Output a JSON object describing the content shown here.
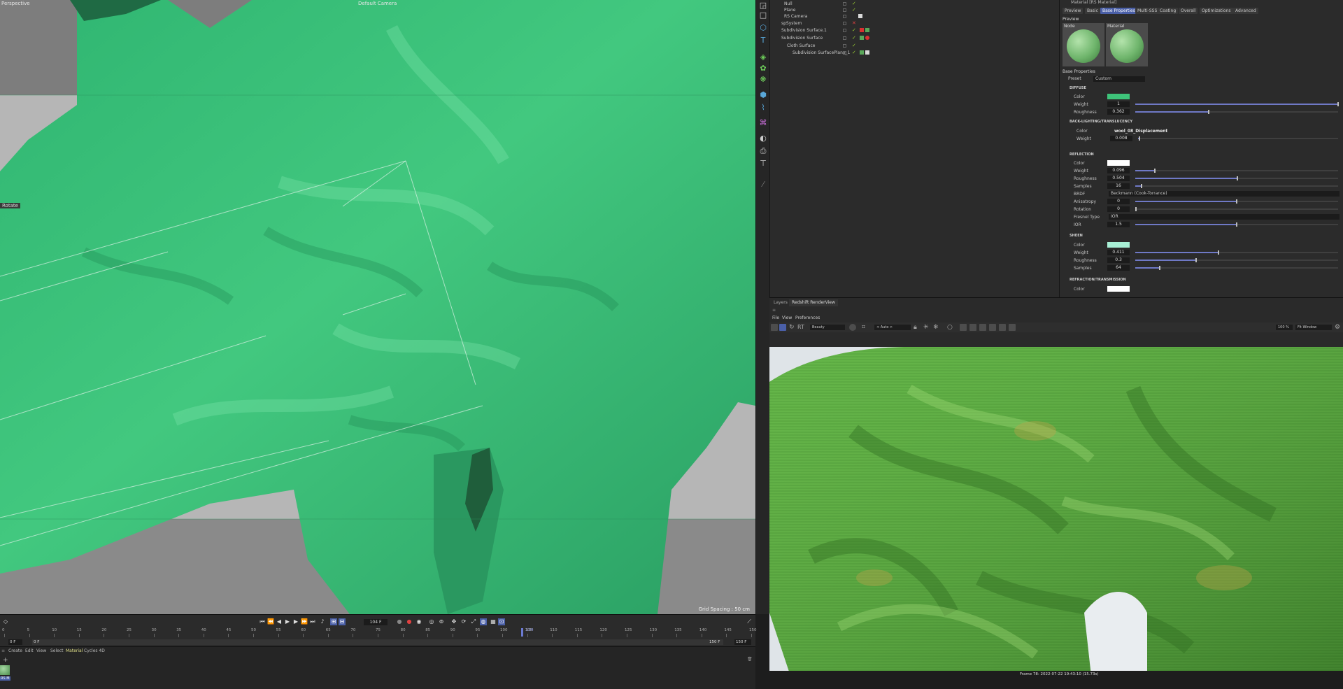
{
  "viewport": {
    "view_name": "Perspective",
    "camera": "Default Camera",
    "rotate_hint": "Rotate",
    "grid_spacing": "Grid Spacing : 50 cm"
  },
  "object_manager": {
    "objects": [
      {
        "name": "Null"
      },
      {
        "name": "Plane"
      },
      {
        "name": "RS Camera"
      },
      {
        "name": "spSystem"
      },
      {
        "name": "Subdivision Surface.1"
      },
      {
        "name": "Subdivision Surface"
      },
      {
        "name": "Cloth Surface"
      },
      {
        "name": "Subdivision SurfacePlane_1"
      }
    ]
  },
  "attribute_manager": {
    "title": "Material [RS Material]",
    "tabs": [
      "Preview",
      "Basic",
      "Base Properties",
      "Multi-SSS",
      "Coating",
      "Overall",
      "Optimizations",
      "Advanced"
    ],
    "active_tab": "Base Properties",
    "preview_label": "Preview",
    "preview_node": "Node",
    "preview_material": "Material",
    "base_properties_label": "Base Properties",
    "preset_label": "Preset",
    "preset_value": "Custom",
    "diffuse": {
      "header": "DIFFUSE",
      "color_label": "Color",
      "color": "#3ec47a",
      "weight_label": "Weight",
      "weight": "1",
      "weight_fraction": 1.0,
      "roughness_label": "Roughness",
      "roughness": "0.362",
      "roughness_fraction": 0.362
    },
    "backlighting": {
      "header": "BACK-LIGHTING/TRANSLUCENCY",
      "color_label": "Color",
      "color_map": "wool_08_Displacement",
      "weight_label": "Weight",
      "weight": "0.008",
      "weight_fraction": 0.008
    },
    "reflection": {
      "header": "REFLECTION",
      "color_label": "Color",
      "color": "#ffffff",
      "weight_label": "Weight",
      "weight": "0.096",
      "weight_fraction": 0.096,
      "roughness_label": "Roughness",
      "roughness": "0.504",
      "roughness_fraction": 0.504,
      "samples_label": "Samples",
      "samples": "16",
      "samples_fraction": 0.03,
      "brdf_label": "BRDF",
      "brdf": "Beckmann (Cook-Torrance)",
      "anisotropy_label": "Anisotropy",
      "anisotropy": "0",
      "anisotropy_fraction": 0.5,
      "rotation_label": "Rotation",
      "rotation": "0",
      "rotation_fraction": 0.0,
      "fresnel_label": "Fresnel Type",
      "fresnel": "IOR",
      "ior_label": "IOR",
      "ior": "1.5",
      "ior_fraction": 0.5
    },
    "sheen": {
      "header": "SHEEN",
      "color_label": "Color",
      "color": "#a8f0d6",
      "weight_label": "Weight",
      "weight": "0.411",
      "weight_fraction": 0.411,
      "roughness_label": "Roughness",
      "roughness": "0.3",
      "roughness_fraction": 0.3,
      "samples_label": "Samples",
      "samples": "64",
      "samples_fraction": 0.12
    },
    "refraction": {
      "header": "REFRACTION/TRANSMISSION",
      "color_label": "Color",
      "color": "#ffffff"
    }
  },
  "render_view": {
    "tabs": [
      "Layers",
      "Redshift RenderView"
    ],
    "active_tab": "Redshift RenderView",
    "menu": [
      "File",
      "View",
      "Preferences"
    ],
    "aov": "Beauty",
    "camera": "< Auto >",
    "zoom": "100 %",
    "fit": "Fit Window",
    "status": "Frame  78:  2022-07-22  19:43:10  (15.73s)"
  },
  "timeline": {
    "current_frame": "104 F",
    "ticks": [
      "0",
      "5",
      "10",
      "15",
      "20",
      "25",
      "30",
      "35",
      "40",
      "45",
      "50",
      "55",
      "60",
      "65",
      "70",
      "75",
      "80",
      "85",
      "90",
      "95",
      "100",
      "105",
      "110",
      "115",
      "120",
      "125",
      "130",
      "135",
      "140",
      "145",
      "150"
    ],
    "playhead_label": "104",
    "start_frame": "0 F",
    "min_frame": "0 F",
    "max_frame": "150 F",
    "end_frame": "150 F"
  },
  "material_manager": {
    "menu": [
      "Create",
      "Edit",
      "View",
      "Select",
      "Material",
      "Cycles 4D"
    ],
    "active_menu": "Material",
    "material_name": "RS M"
  },
  "colors": {
    "accent": "#4a5fa7",
    "cloth_viewport": "#3ec47a",
    "cloth_render": "#5fb245"
  }
}
